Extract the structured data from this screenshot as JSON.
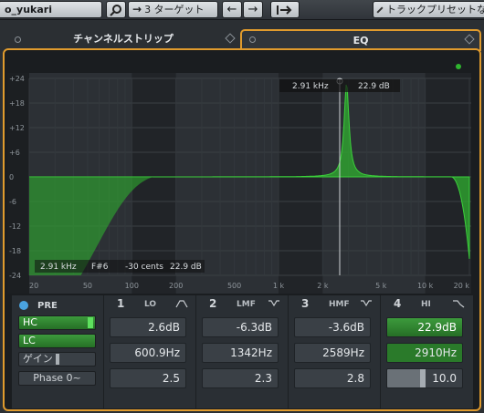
{
  "toolbar": {
    "channel_name": "o_yukari",
    "target_label": "3 ターゲット",
    "preset_label": "トラックプリセットなし"
  },
  "tabs": {
    "channel_strip": "チャンネルストリップ",
    "eq": "EQ"
  },
  "graph": {
    "y_ticks": [
      "+24",
      "+18",
      "+12",
      "+6",
      "0",
      "-6",
      "-12",
      "-18",
      "-24"
    ],
    "x_ticks": [
      "20",
      "50",
      "100",
      "200",
      "500",
      "1 k",
      "2 k",
      "5 k",
      "10 k",
      "20 k"
    ],
    "cursor_freq": "2.91 kHz",
    "cursor_gain": "22.9 dB",
    "readout": {
      "freq": "2.91 kHz",
      "note": "F#6",
      "cents": "-30 cents",
      "gain": "22.9 dB"
    }
  },
  "pre": {
    "label": "PRE",
    "hc": "HC",
    "lc": "LC",
    "gain": "ゲイン",
    "phase": "Phase 0~"
  },
  "bands": [
    {
      "num": "1",
      "name": "LO",
      "gain": "2.6dB",
      "freq": "600.9Hz",
      "q": "2.5"
    },
    {
      "num": "2",
      "name": "LMF",
      "gain": "-6.3dB",
      "freq": "1342Hz",
      "q": "2.3"
    },
    {
      "num": "3",
      "name": "HMF",
      "gain": "-3.6dB",
      "freq": "2589Hz",
      "q": "2.8"
    },
    {
      "num": "4",
      "name": "HI",
      "gain": "22.9dB",
      "freq": "2910Hz",
      "q": "10.0"
    }
  ],
  "colors": {
    "accent": "#e09b2d",
    "curve": "#2fae2f"
  }
}
